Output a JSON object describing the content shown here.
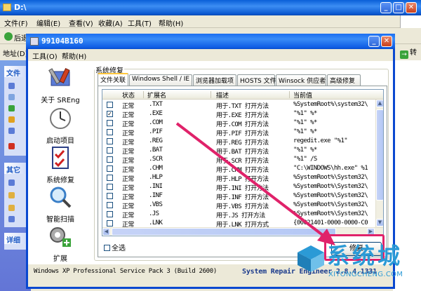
{
  "background_window": {
    "title": "D:\\",
    "menu": [
      "文件(F)",
      "编辑(E)",
      "查看(V)",
      "收藏(A)",
      "工具(T)",
      "帮助(H)"
    ],
    "toolbar_back": "后退",
    "address_label": "地址(D)",
    "go_label": "转到",
    "side_panels": [
      "文件",
      "其它",
      "详细"
    ]
  },
  "app": {
    "title": "99104B160",
    "menu": [
      "工具(O)",
      "帮助(H)"
    ],
    "nav": [
      {
        "label": "关于 SREng",
        "icon": "tools-icon"
      },
      {
        "label": "启动项目",
        "icon": "clock-icon"
      },
      {
        "label": "系统修复",
        "icon": "checklist-icon"
      },
      {
        "label": "智能扫描",
        "icon": "magnifier-icon"
      },
      {
        "label": "扩展",
        "icon": "gears-plus-icon"
      }
    ],
    "group_label": "系统修复",
    "tabs": [
      "文件关联",
      "Windows Shell / IE",
      "浏览器加载项",
      "HOSTS 文件",
      "Winsock 供应者",
      "高级修复"
    ],
    "active_tab": 0,
    "columns": [
      "状态",
      "扩展名",
      "描述",
      "当前值"
    ],
    "rows": [
      {
        "checked": false,
        "status": "正常",
        "ext": ".TXT",
        "desc": "用于.TXT 打开方法",
        "value": "%SystemRoot%\\system32\\"
      },
      {
        "checked": true,
        "status": "正常",
        "ext": ".EXE",
        "desc": "用于.EXE 打开方法",
        "value": "\"%1\" %*"
      },
      {
        "checked": false,
        "status": "正常",
        "ext": ".COM",
        "desc": "用于.COM 打开方法",
        "value": "\"%1\" %*"
      },
      {
        "checked": false,
        "status": "正常",
        "ext": ".PIF",
        "desc": "用于.PIF 打开方法",
        "value": "\"%1\" %*"
      },
      {
        "checked": false,
        "status": "正常",
        "ext": ".REG",
        "desc": "用于.REG 打开方法",
        "value": "regedit.exe \"%1\""
      },
      {
        "checked": false,
        "status": "正常",
        "ext": ".BAT",
        "desc": "用于.BAT 打开方法",
        "value": "\"%1\" %*"
      },
      {
        "checked": false,
        "status": "正常",
        "ext": ".SCR",
        "desc": "用于.SCR 打开方法",
        "value": "\"%1\" /S"
      },
      {
        "checked": false,
        "status": "正常",
        "ext": ".CHM",
        "desc": "用于.CHM 打开方法",
        "value": "\"C:\\WINDOWS\\hh.exe\" %1"
      },
      {
        "checked": false,
        "status": "正常",
        "ext": ".HLP",
        "desc": "用于.HLP 打开方法",
        "value": "%SystemRoot%\\System32\\"
      },
      {
        "checked": false,
        "status": "正常",
        "ext": ".INI",
        "desc": "用于.INI 打开方法",
        "value": "%SystemRoot%\\System32\\"
      },
      {
        "checked": false,
        "status": "正常",
        "ext": ".INF",
        "desc": "用于.INF 打开方法",
        "value": "%SystemRoot%\\System32\\"
      },
      {
        "checked": false,
        "status": "正常",
        "ext": ".VBS",
        "desc": "用于.VBS 打开方法",
        "value": "%SystemRoot%\\System32\\"
      },
      {
        "checked": false,
        "status": "正常",
        "ext": ".JS",
        "desc": "用于.JS 打开方法",
        "value": "%SystemRoot%\\System32\\"
      },
      {
        "checked": false,
        "status": "正常",
        "ext": ".LNK",
        "desc": "用于.LNK 打开方式",
        "value": "{00021401-0000-0000-C0"
      }
    ],
    "select_all_label": "全选",
    "fix_button_label": "修复",
    "status_left": "Windows XP Professional Service Pack 3 (Build 2600)",
    "status_right": "System Repair Engineer 2.8.4.1331"
  },
  "watermark": {
    "big": "系统城",
    "small": "XITONGCHENG.COM"
  },
  "colors": {
    "xp_blue": "#0a48d0",
    "annotation": "#e0226a",
    "watermark": "#2b9ad6"
  }
}
